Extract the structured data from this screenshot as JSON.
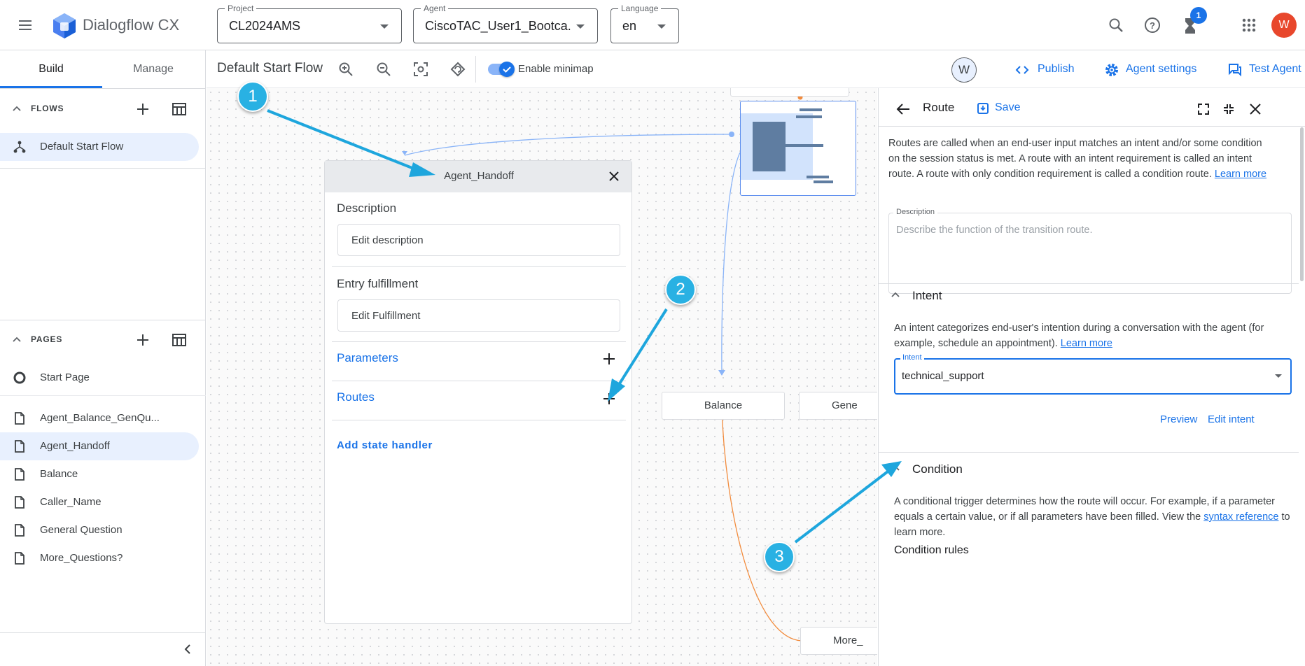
{
  "app": {
    "title": "Dialogflow CX"
  },
  "project": {
    "label": "Project",
    "value": "CL2024AMS"
  },
  "agent": {
    "label": "Agent",
    "value": "CiscoTAC_User1_Bootca..."
  },
  "language": {
    "label": "Language",
    "value": "en"
  },
  "topbar": {
    "notification_count": "1",
    "avatar_letter": "W"
  },
  "tabs": {
    "build": "Build",
    "manage": "Manage"
  },
  "flows": {
    "header": "FLOWS",
    "items": [
      {
        "label": "Default Start Flow"
      }
    ]
  },
  "pages": {
    "header": "PAGES",
    "items": [
      {
        "label": "Start Page"
      },
      {
        "label": "Agent_Balance_GenQu..."
      },
      {
        "label": "Agent_Handoff"
      },
      {
        "label": "Balance"
      },
      {
        "label": "Caller_Name"
      },
      {
        "label": "General Question"
      },
      {
        "label": "More_Questions?"
      }
    ]
  },
  "toolbar": {
    "flow_title": "Default Start Flow",
    "minimap_label": "Enable minimap",
    "user_avatar": "W",
    "publish": "Publish",
    "agent_settings": "Agent settings",
    "test_agent": "Test Agent"
  },
  "card": {
    "title": "Agent_Handoff",
    "description_label": "Description",
    "edit_description": "Edit description",
    "entry_label": "Entry fulfillment",
    "edit_fulfillment": "Edit Fulfillment",
    "parameters": "Parameters",
    "routes": "Routes",
    "add_state_handler": "Add state handler"
  },
  "nodes": {
    "balance": "Balance",
    "general": "Gene",
    "more": "More_"
  },
  "route": {
    "title": "Route",
    "save": "Save",
    "intro": "Routes are called when an end-user input matches an intent and/or some condition on the session status is met. A route with an intent requirement is called an intent route. A route with only condition requirement is called a condition route.",
    "learn_more": "Learn more",
    "description_label": "Description",
    "description_placeholder": "Describe the function of the transition route.",
    "intent_section": "Intent",
    "intent_text": "An intent categorizes end-user's intention during a conversation with the agent (for example, schedule an appointment).",
    "intent_learn_more": "Learn more",
    "intent_label": "Intent",
    "intent_value": "technical_support",
    "preview": "Preview",
    "edit_intent": "Edit intent",
    "condition_section": "Condition",
    "condition_text_a": "A conditional trigger determines how the route will occur. For example, if a parameter equals a certain value, or if all parameters have been filled. View the",
    "condition_link": "syntax reference",
    "condition_text_b": "to learn more.",
    "condition_rules": "Condition rules"
  },
  "annotations": [
    "1",
    "2",
    "3"
  ],
  "colors": {
    "accent": "#1a73e8",
    "annotation": "#29b1e3",
    "route_line": "#f28b3c",
    "avatar": "#e8472c"
  }
}
